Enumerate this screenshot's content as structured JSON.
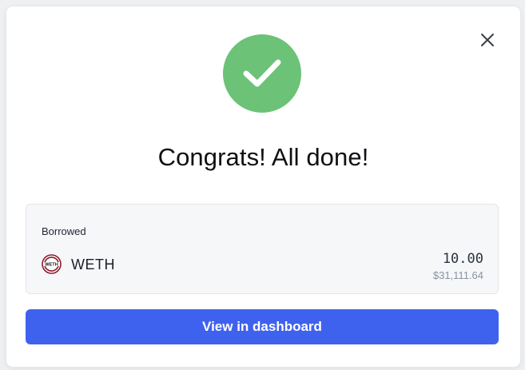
{
  "modal": {
    "close_icon": "close-icon",
    "success_icon": "checkmark-icon",
    "title": "Congrats! All done!"
  },
  "summary": {
    "label": "Borrowed",
    "token": {
      "icon": "weth-token-icon",
      "icon_text": "WETH",
      "symbol": "WETH",
      "amount": "10.00",
      "amount_usd": "$31,111.64"
    }
  },
  "cta": {
    "label": "View in dashboard"
  },
  "colors": {
    "success": "#6cc276",
    "primary": "#3f62ee",
    "token_icon_accent": "#8b1a2b"
  }
}
